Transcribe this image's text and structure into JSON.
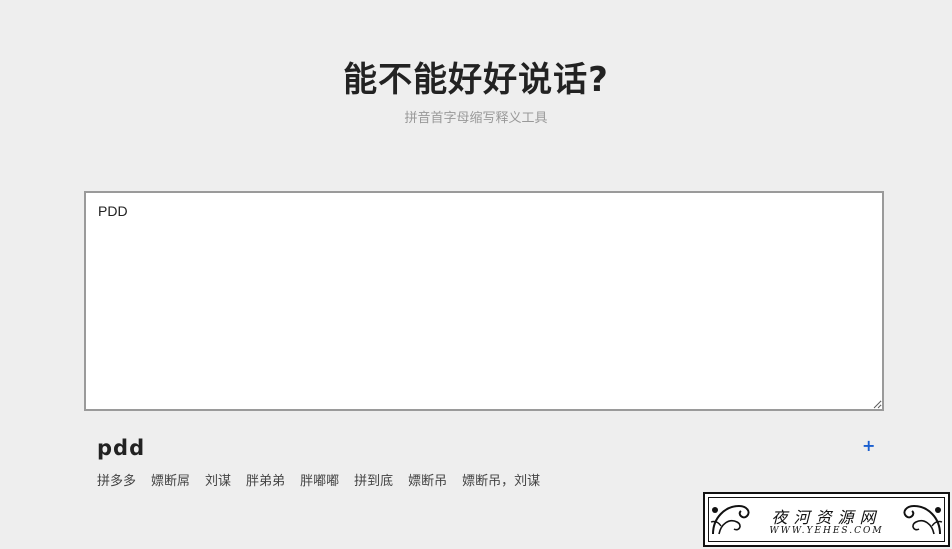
{
  "header": {
    "title": "能不能好好说话?",
    "subtitle": "拼音首字母缩写释义工具"
  },
  "input": {
    "value": "PDD"
  },
  "result": {
    "abbreviation": "pdd",
    "add_label": "+",
    "meanings": [
      "拼多多",
      "嫖断屌",
      "刘谋",
      "胖弟弟",
      "胖嘟嘟",
      "拼到底",
      "嫖断吊",
      "嫖断吊，刘谋"
    ]
  },
  "watermark": {
    "title": "夜河资源网",
    "url": "WWW.YEHES.COM"
  }
}
